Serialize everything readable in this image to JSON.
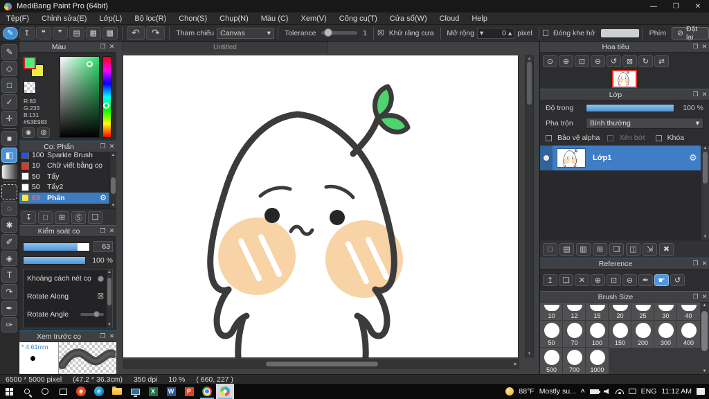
{
  "ui": {
    "popout": "❐",
    "close": "✕",
    "up": "▲",
    "down": "▼",
    "right_arrow": "▶",
    "caret": "▾",
    "spin_up": "▴",
    "eye_dot": "●"
  },
  "window": {
    "title": "MediBang Paint Pro (64bit)",
    "controls": [
      {
        "glyph": "—",
        "name": "minimize-button"
      },
      {
        "glyph": "❐",
        "name": "maximize-button"
      },
      {
        "glyph": "✕",
        "name": "close-button"
      }
    ]
  },
  "menu": {
    "items": [
      "Tệp(F)",
      "Chỉnh sửa(E)",
      "Lớp(L)",
      "Bộ lọc(R)",
      "Chọn(S)",
      "Chụp(N)",
      "Màu (C)",
      "Xem(V)",
      "Công cụ(T)",
      "Cửa sổ(W)",
      "Cloud",
      "Help"
    ]
  },
  "toolbar": {
    "buttons": [
      {
        "glyph": "✎",
        "cls": "round",
        "name": "cloud-brush-button"
      },
      {
        "glyph": "↥",
        "name": "publish-button"
      },
      {
        "glyph": "❝",
        "name": "comment-button"
      },
      {
        "glyph": "❞",
        "name": "chat-button"
      },
      {
        "glyph": "▤",
        "name": "document-button"
      },
      {
        "glyph": "▦",
        "name": "timelapse-button"
      },
      {
        "glyph": "▩",
        "name": "material-button"
      }
    ],
    "undo": "↶",
    "redo": "↷",
    "ref_label": "Tham chiếu",
    "ref_value": "Canvas",
    "tolerance_label": "Tolerance",
    "tolerance_value": "1",
    "antialias_check": "☒",
    "antialias_label": "Khử răng cưa",
    "expand_label": "Mở rộng",
    "expand_value": "0",
    "expand_unit": "pixel",
    "closegap_label": "Đóng khe hở",
    "key_label": "Phím",
    "reset_glyph": "⊘",
    "reset_label": "Đặt lại"
  },
  "tools": [
    {
      "glyph": "✎",
      "name": "brush-tool"
    },
    {
      "glyph": "◇",
      "name": "eraser-tool"
    },
    {
      "glyph": "□",
      "name": "figure-tool"
    },
    {
      "glyph": "✓",
      "name": "polyline-tool"
    },
    {
      "glyph": "✛",
      "name": "move-tool"
    },
    {
      "cls": "tdiv",
      "name": "tool-divider"
    },
    {
      "glyph": "■",
      "name": "fill-rect-tool"
    },
    {
      "glyph": "◧",
      "cls": "active",
      "name": "bucket-tool"
    },
    {
      "cls": "grad",
      "name": "gradient-tool"
    },
    {
      "cls": "tdiv",
      "name": "tool-divider"
    },
    {
      "cls": "dashsq",
      "name": "select-tool"
    },
    {
      "glyph": "◌",
      "name": "lasso-tool"
    },
    {
      "glyph": "✱",
      "name": "magic-wand-tool"
    },
    {
      "glyph": "✐",
      "name": "select-pen-tool"
    },
    {
      "glyph": "◈",
      "name": "select-eraser-tool"
    },
    {
      "glyph": "T",
      "name": "text-tool"
    },
    {
      "glyph": "↷",
      "name": "operation-tool"
    },
    {
      "glyph": "✒",
      "name": "eyedropper-tool"
    },
    {
      "glyph": "✑",
      "name": "divide-tool"
    }
  ],
  "color_panel": {
    "title": "Màu",
    "r": "R:83",
    "g": "G:233",
    "b": "B:131",
    "hex": "#53E983",
    "fg_color": "#53E983",
    "bg_color": "#efe94a",
    "wheel_glyph": "◉",
    "palette_glyph": "◍"
  },
  "brush_panel": {
    "title": "Cọ: Phấn",
    "gear": "⚙",
    "brushes": [
      {
        "size": "100",
        "name": "Sparkle Brush",
        "swatch": "#2b50d8"
      },
      {
        "size": "10",
        "name": "Chữ viết bằng cọ",
        "swatch": "#d93a2b"
      },
      {
        "size": "50",
        "name": "Tẩy",
        "swatch": "#ffffff"
      },
      {
        "size": "50",
        "name": "Tẩy2",
        "swatch": "#ffffff"
      },
      {
        "size": "63",
        "name": "Phấn",
        "swatch": "#efe94a",
        "cls": "selected",
        "size_color": "#e0718c"
      }
    ],
    "buttons": [
      {
        "glyph": "↧",
        "name": "cloud-brush-download-button"
      },
      {
        "glyph": "□",
        "name": "add-brush-button"
      },
      {
        "glyph": "⊞",
        "name": "add-brush-options-button"
      },
      {
        "glyph": "Ⓢ",
        "name": "script-brush-button"
      },
      {
        "glyph": "❏",
        "name": "brush-folder-button"
      }
    ]
  },
  "brush_control": {
    "title": "Kiểm soát cọ",
    "size_value": "63",
    "opacity_value": "100 %",
    "opt1": "Khoảng cách nét cọ",
    "opt2": "Rotate Along",
    "opt2_check": "☒",
    "opt3": "Rotate Angle"
  },
  "brush_preview": {
    "title": "Xem trước cọ",
    "size_label": "* 4.61mm"
  },
  "canvas_area": {
    "tab": "Untitled"
  },
  "navigator": {
    "title": "Hoa tiêu",
    "buttons": [
      {
        "glyph": "⊙",
        "name": "zoom-100-button"
      },
      {
        "glyph": "⊕",
        "name": "zoom-in-button"
      },
      {
        "glyph": "⊡",
        "name": "fit-window-button"
      },
      {
        "glyph": "⊖",
        "name": "zoom-out-button"
      },
      {
        "glyph": "↺",
        "name": "rotate-left-button"
      },
      {
        "glyph": "⊠",
        "name": "reset-rotation-button"
      },
      {
        "glyph": "↻",
        "name": "rotate-right-button"
      },
      {
        "glyph": "⇄",
        "name": "flip-view-button"
      }
    ]
  },
  "layer_panel": {
    "title": "Lớp",
    "opacity_label": "Độ trong",
    "opacity_value": "100 %",
    "blend_label": "Pha trộn",
    "blend_value": "Bình thường",
    "check_alpha": "Bảo vệ alpha",
    "check_clip": "Xén bớt",
    "check_lock": "Khóa",
    "layer_name": "Lớp1",
    "gear": "⚙",
    "buttons": [
      {
        "glyph": "□",
        "name": "new-layer-button"
      },
      {
        "glyph": "▤",
        "name": "new-halftone-layer-button"
      },
      {
        "glyph": "▥",
        "name": "new-8bit-layer-button"
      },
      {
        "glyph": "⊞",
        "name": "add-layer-options-button"
      },
      {
        "glyph": "❏",
        "name": "new-folder-button"
      },
      {
        "glyph": "◫",
        "name": "duplicate-layer-button"
      },
      {
        "glyph": "⇲",
        "name": "merge-down-button"
      },
      {
        "glyph": "✖",
        "name": "delete-layer-button"
      }
    ]
  },
  "reference_panel": {
    "title": "Reference",
    "buttons": [
      {
        "glyph": "↥",
        "name": "cloud-open-button"
      },
      {
        "glyph": "❏",
        "name": "open-file-button"
      },
      {
        "glyph": "✕",
        "name": "clear-button"
      },
      {
        "glyph": "⊕",
        "name": "zoom-in-button"
      },
      {
        "glyph": "⊡",
        "name": "fit-button"
      },
      {
        "glyph": "⊖",
        "name": "zoom-out-button"
      },
      {
        "glyph": "✒",
        "name": "eyedropper-button"
      },
      {
        "glyph": "☛",
        "cls": "active",
        "name": "hand-button"
      },
      {
        "glyph": "↺",
        "name": "rotate-button"
      }
    ]
  },
  "brush_size_panel": {
    "title": "Brush Size",
    "sizes": [
      {
        "label": "10",
        "cls": "partial"
      },
      {
        "label": "12",
        "cls": "partial"
      },
      {
        "label": "15",
        "cls": "partial"
      },
      {
        "label": "20",
        "cls": "partial"
      },
      {
        "label": "25",
        "cls": "partial"
      },
      {
        "label": "30",
        "cls": "partial"
      },
      {
        "label": "40",
        "cls": "partial"
      },
      {
        "label": "50"
      },
      {
        "label": "70"
      },
      {
        "label": "100"
      },
      {
        "label": "150"
      },
      {
        "label": "200"
      },
      {
        "label": "300"
      },
      {
        "label": "400"
      },
      {
        "label": "500"
      },
      {
        "label": "700"
      },
      {
        "label": "1000"
      }
    ]
  },
  "statusbar": {
    "dims": "6500 * 5000 pixel",
    "size_cm": "(47.2 * 36.3cm)",
    "dpi": "350 dpi",
    "zoom": "10 %",
    "coords": "( 660, 227 )"
  },
  "taskbar": {
    "edge_letter": "e",
    "ie_letter": "e",
    "excel_letter": "X",
    "word_letter": "W",
    "ppt_letter": "P",
    "weather_temp": "88°F",
    "weather_text": "Mostly su...",
    "chevron": "^",
    "lang": "ENG",
    "time": "11:12 AM"
  }
}
